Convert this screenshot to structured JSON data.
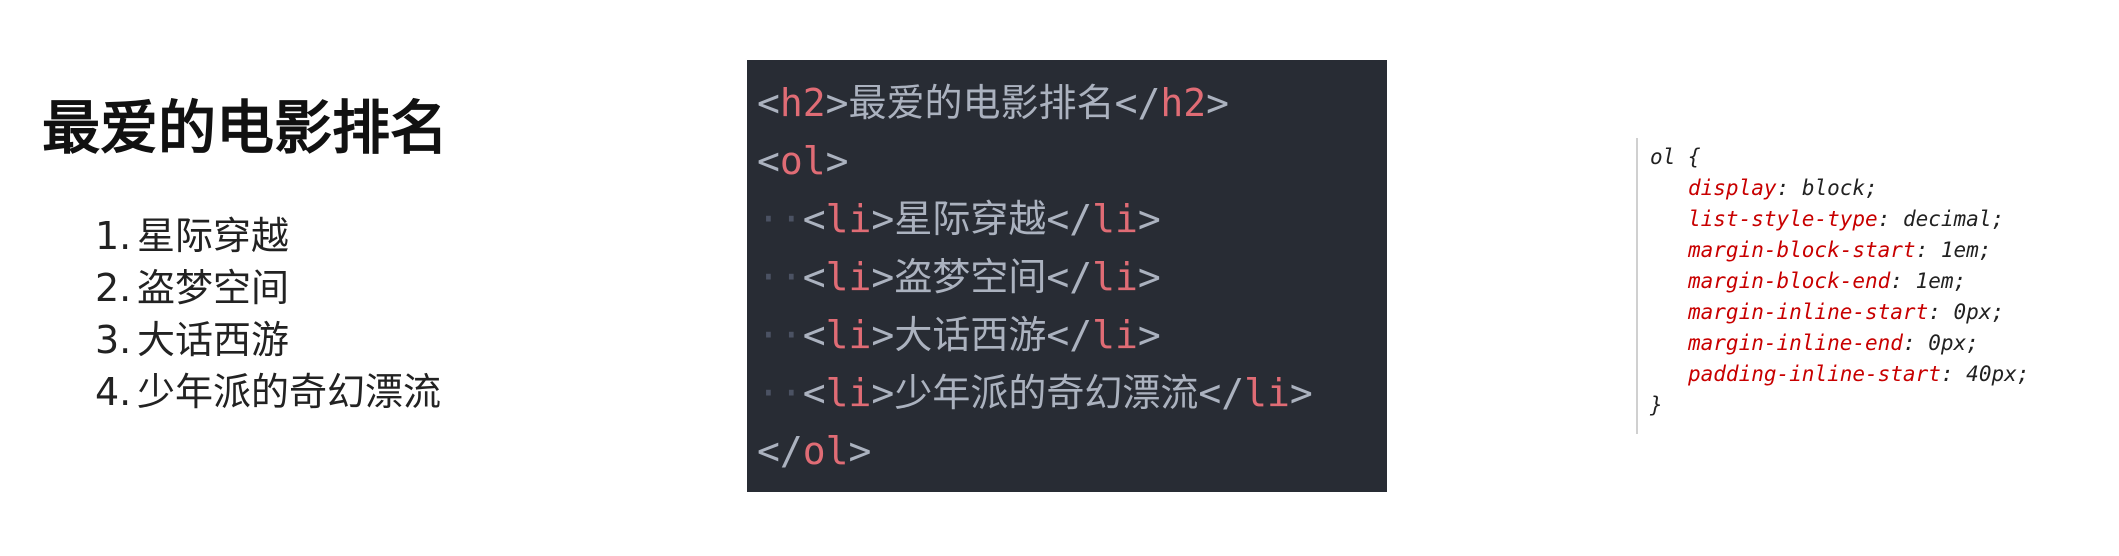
{
  "preview": {
    "heading": "最爱的电影排名",
    "items": [
      {
        "num": "1.",
        "text": "星际穿越"
      },
      {
        "num": "2.",
        "text": "盗梦空间"
      },
      {
        "num": "3.",
        "text": "大话西游"
      },
      {
        "num": "4.",
        "text": "少年派的奇幻漂流"
      }
    ]
  },
  "editor": {
    "theme_bg": "#282c34",
    "tag_color": "#e06c75",
    "text_color": "#abb2bf",
    "h2_line": {
      "open": "<",
      "tag": "h2",
      "gt": ">",
      "text": "最爱的电影排名",
      "close_open": "</",
      "close_tag": "h2",
      "close_gt": ">"
    },
    "ol_open": {
      "open": "<",
      "tag": "ol",
      "gt": ">"
    },
    "li_lines": [
      {
        "text": "星际穿越"
      },
      {
        "text": "盗梦空间"
      },
      {
        "text": "大话西游"
      },
      {
        "text": "少年派的奇幻漂流"
      }
    ],
    "li_tag": "li",
    "ol_close": {
      "open": "</",
      "tag": "ol",
      "gt": ">"
    }
  },
  "devtools": {
    "selector": "ol {",
    "properties": [
      {
        "name": "display",
        "value": "block;"
      },
      {
        "name": "list-style-type",
        "value": "decimal;"
      },
      {
        "name": "margin-block-start",
        "value": "1em;"
      },
      {
        "name": "margin-block-end",
        "value": "1em;"
      },
      {
        "name": "margin-inline-start",
        "value": "0px;"
      },
      {
        "name": "margin-inline-end",
        "value": "0px;"
      },
      {
        "name": "padding-inline-start",
        "value": "40px;"
      }
    ],
    "close": "}",
    "prop_color": "#c80000"
  }
}
